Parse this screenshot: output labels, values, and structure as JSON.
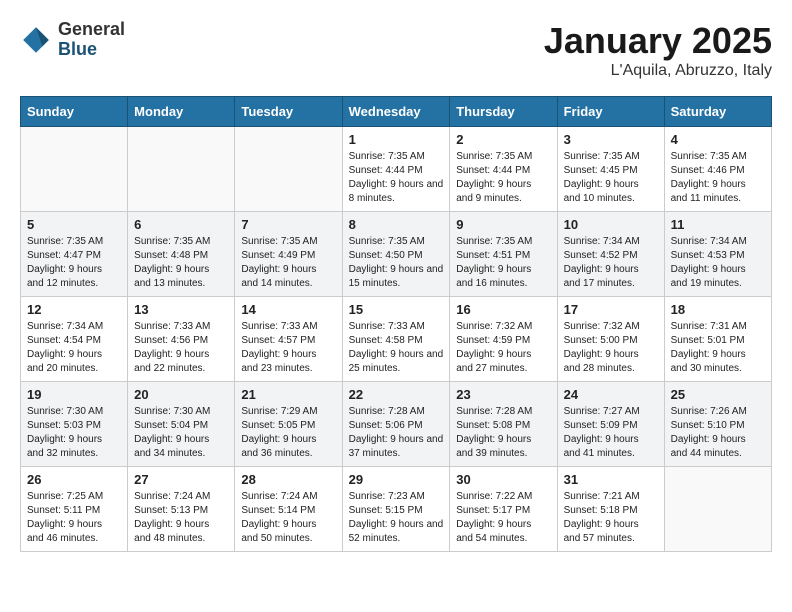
{
  "header": {
    "logo_general": "General",
    "logo_blue": "Blue",
    "month": "January 2025",
    "location": "L'Aquila, Abruzzo, Italy"
  },
  "weekdays": [
    "Sunday",
    "Monday",
    "Tuesday",
    "Wednesday",
    "Thursday",
    "Friday",
    "Saturday"
  ],
  "weeks": [
    [
      {
        "day": "",
        "sunrise": "",
        "sunset": "",
        "daylight": ""
      },
      {
        "day": "",
        "sunrise": "",
        "sunset": "",
        "daylight": ""
      },
      {
        "day": "",
        "sunrise": "",
        "sunset": "",
        "daylight": ""
      },
      {
        "day": "1",
        "sunrise": "Sunrise: 7:35 AM",
        "sunset": "Sunset: 4:44 PM",
        "daylight": "Daylight: 9 hours and 8 minutes."
      },
      {
        "day": "2",
        "sunrise": "Sunrise: 7:35 AM",
        "sunset": "Sunset: 4:44 PM",
        "daylight": "Daylight: 9 hours and 9 minutes."
      },
      {
        "day": "3",
        "sunrise": "Sunrise: 7:35 AM",
        "sunset": "Sunset: 4:45 PM",
        "daylight": "Daylight: 9 hours and 10 minutes."
      },
      {
        "day": "4",
        "sunrise": "Sunrise: 7:35 AM",
        "sunset": "Sunset: 4:46 PM",
        "daylight": "Daylight: 9 hours and 11 minutes."
      }
    ],
    [
      {
        "day": "5",
        "sunrise": "Sunrise: 7:35 AM",
        "sunset": "Sunset: 4:47 PM",
        "daylight": "Daylight: 9 hours and 12 minutes."
      },
      {
        "day": "6",
        "sunrise": "Sunrise: 7:35 AM",
        "sunset": "Sunset: 4:48 PM",
        "daylight": "Daylight: 9 hours and 13 minutes."
      },
      {
        "day": "7",
        "sunrise": "Sunrise: 7:35 AM",
        "sunset": "Sunset: 4:49 PM",
        "daylight": "Daylight: 9 hours and 14 minutes."
      },
      {
        "day": "8",
        "sunrise": "Sunrise: 7:35 AM",
        "sunset": "Sunset: 4:50 PM",
        "daylight": "Daylight: 9 hours and 15 minutes."
      },
      {
        "day": "9",
        "sunrise": "Sunrise: 7:35 AM",
        "sunset": "Sunset: 4:51 PM",
        "daylight": "Daylight: 9 hours and 16 minutes."
      },
      {
        "day": "10",
        "sunrise": "Sunrise: 7:34 AM",
        "sunset": "Sunset: 4:52 PM",
        "daylight": "Daylight: 9 hours and 17 minutes."
      },
      {
        "day": "11",
        "sunrise": "Sunrise: 7:34 AM",
        "sunset": "Sunset: 4:53 PM",
        "daylight": "Daylight: 9 hours and 19 minutes."
      }
    ],
    [
      {
        "day": "12",
        "sunrise": "Sunrise: 7:34 AM",
        "sunset": "Sunset: 4:54 PM",
        "daylight": "Daylight: 9 hours and 20 minutes."
      },
      {
        "day": "13",
        "sunrise": "Sunrise: 7:33 AM",
        "sunset": "Sunset: 4:56 PM",
        "daylight": "Daylight: 9 hours and 22 minutes."
      },
      {
        "day": "14",
        "sunrise": "Sunrise: 7:33 AM",
        "sunset": "Sunset: 4:57 PM",
        "daylight": "Daylight: 9 hours and 23 minutes."
      },
      {
        "day": "15",
        "sunrise": "Sunrise: 7:33 AM",
        "sunset": "Sunset: 4:58 PM",
        "daylight": "Daylight: 9 hours and 25 minutes."
      },
      {
        "day": "16",
        "sunrise": "Sunrise: 7:32 AM",
        "sunset": "Sunset: 4:59 PM",
        "daylight": "Daylight: 9 hours and 27 minutes."
      },
      {
        "day": "17",
        "sunrise": "Sunrise: 7:32 AM",
        "sunset": "Sunset: 5:00 PM",
        "daylight": "Daylight: 9 hours and 28 minutes."
      },
      {
        "day": "18",
        "sunrise": "Sunrise: 7:31 AM",
        "sunset": "Sunset: 5:01 PM",
        "daylight": "Daylight: 9 hours and 30 minutes."
      }
    ],
    [
      {
        "day": "19",
        "sunrise": "Sunrise: 7:30 AM",
        "sunset": "Sunset: 5:03 PM",
        "daylight": "Daylight: 9 hours and 32 minutes."
      },
      {
        "day": "20",
        "sunrise": "Sunrise: 7:30 AM",
        "sunset": "Sunset: 5:04 PM",
        "daylight": "Daylight: 9 hours and 34 minutes."
      },
      {
        "day": "21",
        "sunrise": "Sunrise: 7:29 AM",
        "sunset": "Sunset: 5:05 PM",
        "daylight": "Daylight: 9 hours and 36 minutes."
      },
      {
        "day": "22",
        "sunrise": "Sunrise: 7:28 AM",
        "sunset": "Sunset: 5:06 PM",
        "daylight": "Daylight: 9 hours and 37 minutes."
      },
      {
        "day": "23",
        "sunrise": "Sunrise: 7:28 AM",
        "sunset": "Sunset: 5:08 PM",
        "daylight": "Daylight: 9 hours and 39 minutes."
      },
      {
        "day": "24",
        "sunrise": "Sunrise: 7:27 AM",
        "sunset": "Sunset: 5:09 PM",
        "daylight": "Daylight: 9 hours and 41 minutes."
      },
      {
        "day": "25",
        "sunrise": "Sunrise: 7:26 AM",
        "sunset": "Sunset: 5:10 PM",
        "daylight": "Daylight: 9 hours and 44 minutes."
      }
    ],
    [
      {
        "day": "26",
        "sunrise": "Sunrise: 7:25 AM",
        "sunset": "Sunset: 5:11 PM",
        "daylight": "Daylight: 9 hours and 46 minutes."
      },
      {
        "day": "27",
        "sunrise": "Sunrise: 7:24 AM",
        "sunset": "Sunset: 5:13 PM",
        "daylight": "Daylight: 9 hours and 48 minutes."
      },
      {
        "day": "28",
        "sunrise": "Sunrise: 7:24 AM",
        "sunset": "Sunset: 5:14 PM",
        "daylight": "Daylight: 9 hours and 50 minutes."
      },
      {
        "day": "29",
        "sunrise": "Sunrise: 7:23 AM",
        "sunset": "Sunset: 5:15 PM",
        "daylight": "Daylight: 9 hours and 52 minutes."
      },
      {
        "day": "30",
        "sunrise": "Sunrise: 7:22 AM",
        "sunset": "Sunset: 5:17 PM",
        "daylight": "Daylight: 9 hours and 54 minutes."
      },
      {
        "day": "31",
        "sunrise": "Sunrise: 7:21 AM",
        "sunset": "Sunset: 5:18 PM",
        "daylight": "Daylight: 9 hours and 57 minutes."
      },
      {
        "day": "",
        "sunrise": "",
        "sunset": "",
        "daylight": ""
      }
    ]
  ]
}
